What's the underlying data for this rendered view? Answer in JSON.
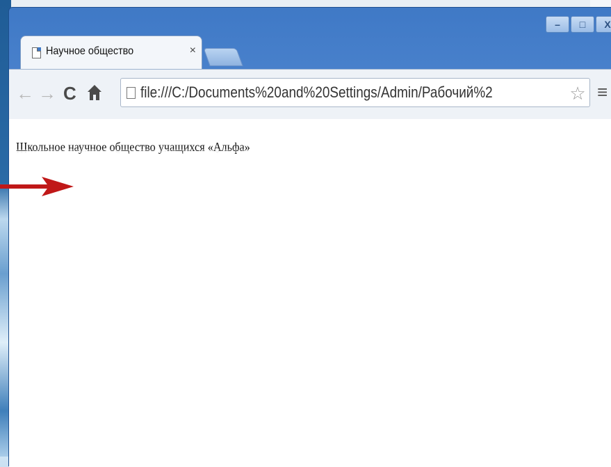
{
  "window": {
    "controls": [
      "–",
      "□",
      "X"
    ]
  },
  "tab": {
    "title": "Научное общество",
    "close": "×"
  },
  "toolbar": {
    "back": "←",
    "forward": "→",
    "reload": "C",
    "home": "🏠",
    "url": "file:///C:/Documents%20and%20Settings/Admin/Рабочий%2",
    "star": "☆",
    "menu": "≡"
  },
  "page": {
    "text": "Школьное научное общество учащихся «Альфа»"
  },
  "colors": {
    "title_bar": "#4a83cf",
    "arrow": "#c01818"
  }
}
